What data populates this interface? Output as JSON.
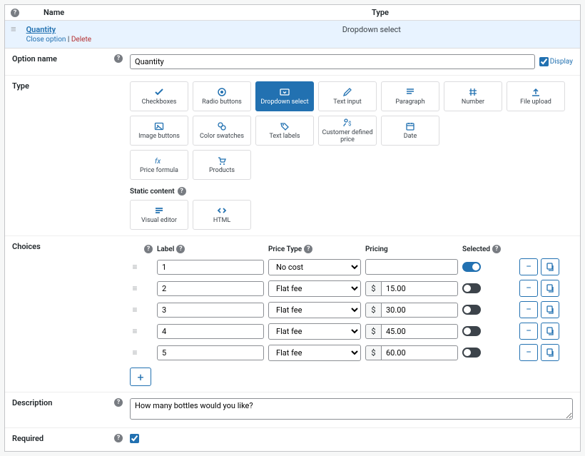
{
  "table": {
    "head_name": "Name",
    "head_type": "Type"
  },
  "row": {
    "title": "Quantity",
    "close": "Close option",
    "delete": "Delete",
    "type": "Dropdown select"
  },
  "option_name": {
    "label": "Option name",
    "value": "Quantity",
    "display_label": "Display"
  },
  "type": {
    "label": "Type",
    "static_label": "Static content",
    "items": [
      {
        "label": "Checkboxes",
        "icon": "check"
      },
      {
        "label": "Radio buttons",
        "icon": "radio"
      },
      {
        "label": "Dropdown select",
        "icon": "dropdown",
        "selected": true
      },
      {
        "label": "Text input",
        "icon": "pencil"
      },
      {
        "label": "Paragraph",
        "icon": "para"
      },
      {
        "label": "Number",
        "icon": "hash"
      },
      {
        "label": "File upload",
        "icon": "upload"
      },
      {
        "label": "Image buttons",
        "icon": "image"
      },
      {
        "label": "Color swatches",
        "icon": "swatch"
      },
      {
        "label": "Text labels",
        "icon": "tag"
      },
      {
        "label": "Customer defined price",
        "icon": "person-dollar"
      },
      {
        "label": "Date",
        "icon": "calendar"
      }
    ],
    "items2": [
      {
        "label": "Price formula",
        "icon": "fx"
      },
      {
        "label": "Products",
        "icon": "cart"
      }
    ],
    "static_items": [
      {
        "label": "Visual editor",
        "icon": "editor"
      },
      {
        "label": "HTML",
        "icon": "html"
      }
    ]
  },
  "choices": {
    "label": "Choices",
    "head_label": "Label",
    "head_ptype": "Price Type",
    "head_price": "Pricing",
    "head_selected": "Selected",
    "ptype_options": [
      "No cost",
      "Flat fee"
    ],
    "currency": "$",
    "rows": [
      {
        "label": "1",
        "ptype": "No cost",
        "price": "",
        "selected": true
      },
      {
        "label": "2",
        "ptype": "Flat fee",
        "price": "15.00",
        "selected": false
      },
      {
        "label": "3",
        "ptype": "Flat fee",
        "price": "30.00",
        "selected": false
      },
      {
        "label": "4",
        "ptype": "Flat fee",
        "price": "45.00",
        "selected": false
      },
      {
        "label": "5",
        "ptype": "Flat fee",
        "price": "60.00",
        "selected": false
      }
    ]
  },
  "description": {
    "label": "Description",
    "value": "How many bottles would you like?"
  },
  "required": {
    "label": "Required",
    "checked": true
  }
}
